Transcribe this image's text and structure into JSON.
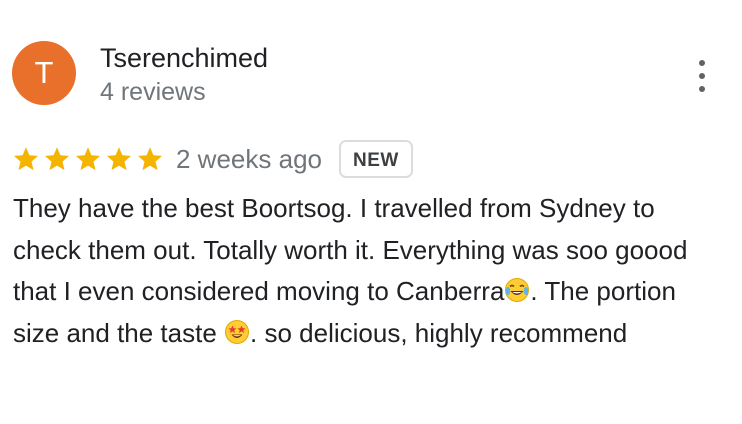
{
  "review": {
    "author": {
      "initial": "T",
      "name": "Tserenchimed",
      "reviews": "4 reviews",
      "avatar_color": "#e8702a"
    },
    "menu_icon": "more-vert-icon",
    "rating": 5,
    "max_rating": 5,
    "star_color": "#f4b400",
    "date": "2 weeks ago",
    "badge": "NEW",
    "text": {
      "part1": "They have the best Boortsog. I travelled from Sydney to check them out. Totally worth it. Everything was soo goood that I even considered moving to Canberra",
      "emoji1": "😂",
      "part2": ". The portion size and the taste ",
      "emoji2": "🤩",
      "part3": ". so delicious, highly recommend"
    }
  }
}
